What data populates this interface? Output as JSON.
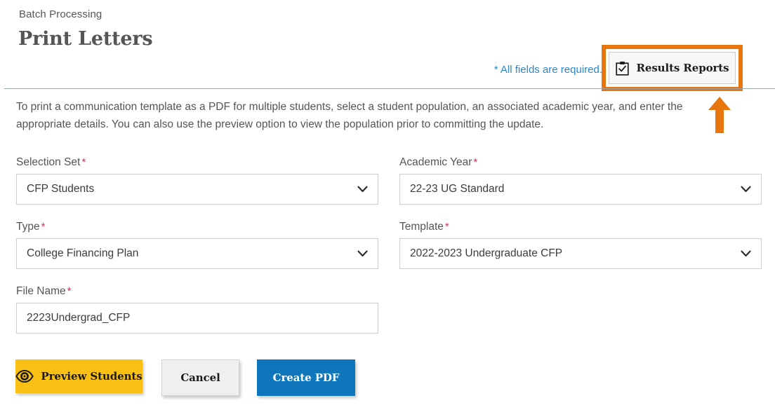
{
  "header": {
    "breadcrumb": "Batch Processing",
    "title": "Print Letters",
    "required_note": "* All fields are required.",
    "results_reports_label": "Results Reports",
    "results_reports_icon": "clipboard-check-icon",
    "highlight_color": "#e8760f",
    "callout_arrow_color": "#e8760f",
    "note_color": "#2b87c8"
  },
  "description": "To print a communication template as a PDF for multiple students, select a student population, an associated academic year, and enter the appropriate details. You can also use the preview option to view the population prior to committing the update.",
  "form": {
    "required_marker": "*",
    "required_marker_color": "#c8385a",
    "fields": [
      {
        "name": "selection-set",
        "label": "Selection Set",
        "required": true,
        "type": "select",
        "value": "CFP Students",
        "icon": "chevron-down-icon"
      },
      {
        "name": "academic-year",
        "label": "Academic Year",
        "required": true,
        "type": "select",
        "value": "22-23 UG Standard",
        "icon": "chevron-down-icon"
      },
      {
        "name": "type",
        "label": "Type",
        "required": true,
        "type": "select",
        "value": "College Financing Plan",
        "icon": "chevron-down-icon"
      },
      {
        "name": "template",
        "label": "Template",
        "required": true,
        "type": "select",
        "value": "2022-2023 Undergraduate CFP",
        "icon": "chevron-down-icon"
      },
      {
        "name": "file-name",
        "label": "File Name",
        "required": true,
        "type": "text",
        "value": "2223Undergrad_CFP",
        "placeholder": ""
      }
    ]
  },
  "actions": {
    "preview_students": {
      "label": "Preview Students",
      "icon": "eye-icon",
      "color": "#fbc014"
    },
    "cancel": {
      "label": "Cancel",
      "color": "#efefef"
    },
    "create_pdf": {
      "label": "Create PDF",
      "color": "#0f76bc"
    }
  }
}
